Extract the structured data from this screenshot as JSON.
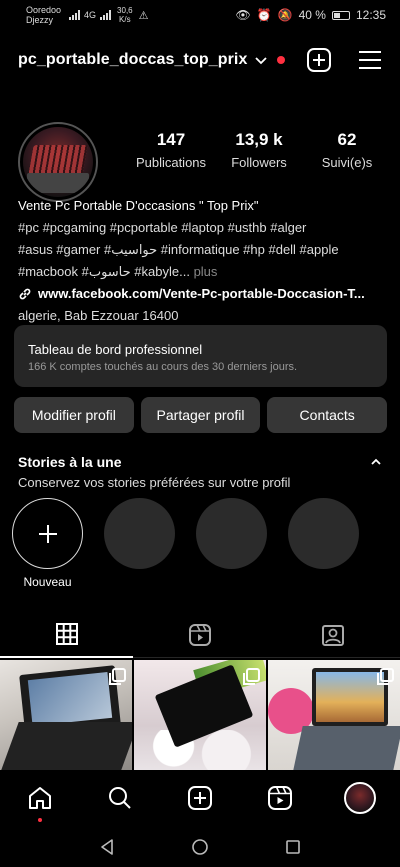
{
  "status_bar": {
    "carrier_name": "Ooredoo",
    "carrier_sub": "Djezzy",
    "network_1": "4G",
    "speed_value": "30,6",
    "speed_unit": "K/s",
    "battery_percent": "40 %",
    "time": "12:35"
  },
  "header": {
    "username": "pc_portable_doccas_top_prix"
  },
  "stats": [
    {
      "value": "147",
      "label": "Publications"
    },
    {
      "value": "13,9 k",
      "label": "Followers"
    },
    {
      "value": "62",
      "label": "Suivi(e)s"
    }
  ],
  "bio": {
    "name": "Vente Pc Portable D'occasions \" Top Prix\"",
    "tags_line1": "#pc #pcgaming #pcportable #laptop #usthb #alger",
    "tags_line2": "#asus #gamer #حواسيب #informatique #hp #dell #apple",
    "tags_line3": "#macbook #حاسوب #kabyle...",
    "more": "plus",
    "link": "www.facebook.com/Vente-Pc-portable-Doccasion-T...",
    "address": "algerie, Bab Ezzouar 16400"
  },
  "dashboard": {
    "title": "Tableau de bord professionnel",
    "subtitle": "166 K comptes touchés au cours des 30 derniers jours."
  },
  "buttons": {
    "edit": "Modifier profil",
    "share": "Partager profil",
    "contacts": "Contacts"
  },
  "stories": {
    "title": "Stories à la une",
    "subtitle": "Conservez vos stories préférées sur votre profil",
    "new_label": "Nouveau"
  },
  "colors": {
    "background": "#000000",
    "card": "#262626",
    "button": "#363636",
    "notification": "#ff3040"
  }
}
